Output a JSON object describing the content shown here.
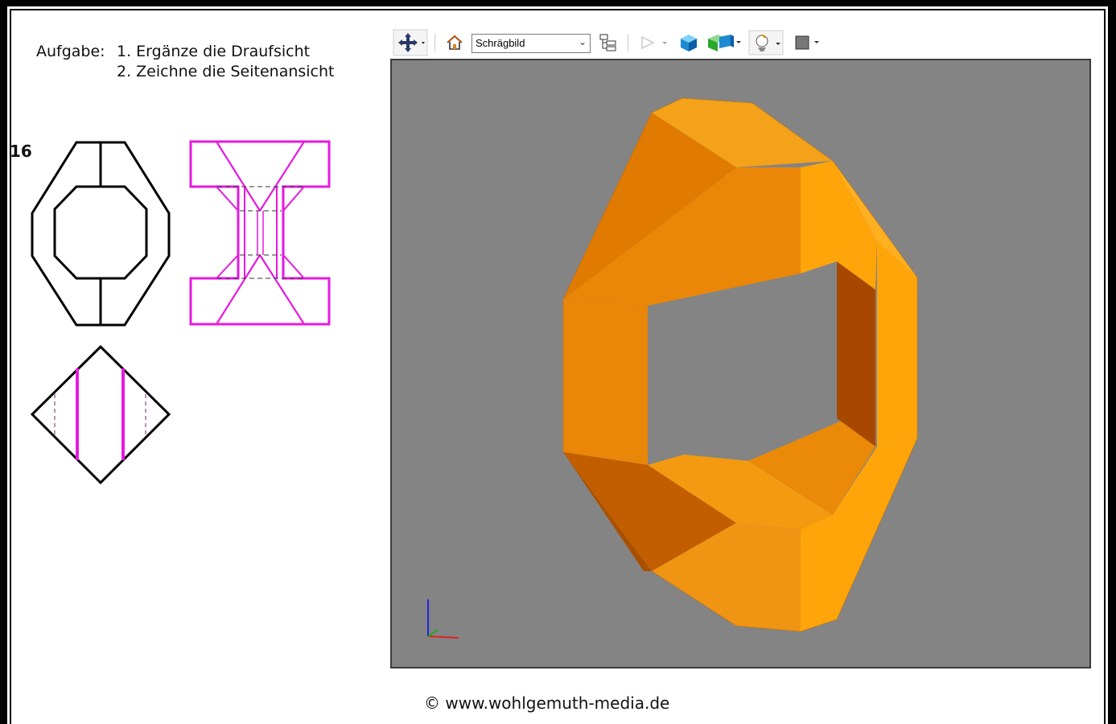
{
  "task": {
    "label": "Aufgabe:",
    "line1": "1. Ergänze die Draufsicht",
    "line2": "2. Zeichne die Seitenansicht"
  },
  "exercise_number": "16",
  "toolbar": {
    "items": [
      {
        "name": "navigate",
        "icon": "move-arrows-icon"
      },
      {
        "name": "home",
        "icon": "home-icon"
      },
      {
        "name": "view",
        "icon": "dropdown"
      },
      {
        "name": "tree",
        "icon": "model-tree-icon"
      },
      {
        "name": "play",
        "icon": "play-icon",
        "disabled": true
      },
      {
        "name": "solid",
        "icon": "cube-icon"
      },
      {
        "name": "section",
        "icon": "section-cube-icon"
      },
      {
        "name": "light",
        "icon": "lighting-icon"
      },
      {
        "name": "background",
        "icon": "background-color-icon"
      }
    ],
    "view_select": {
      "value": "Schrägbild"
    }
  },
  "viewport": {
    "background": "#848484",
    "model_color": "#f5a21a"
  },
  "colors": {
    "magenta": "#e619e0",
    "black": "#000000"
  },
  "footer": {
    "copyright": "© www.wohlgemuth-media.de"
  }
}
